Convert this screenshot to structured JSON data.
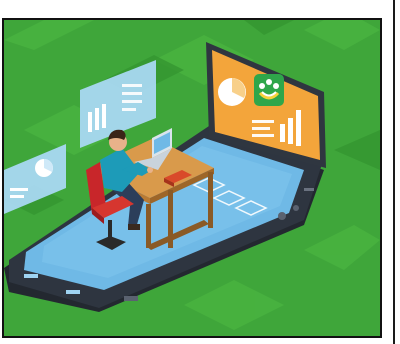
{
  "illustration": {
    "subject": "person-working-at-desk-on-smartphone-platform",
    "colors": {
      "background": "#3fa63a",
      "background_tile": "#49b340",
      "phone_body": "#2e3540",
      "phone_screen": "#6fb9e6",
      "monitor_frame": "#2f3640",
      "monitor_screen": "#f3a53b",
      "app_icon": "#2fa64a",
      "desk": "#c98a3e",
      "chair": "#c8262a",
      "shirt": "#1d9bb8",
      "floating_panel": "#a9d8f2"
    },
    "icons": [
      "pie-chart-icon",
      "bar-chart-icon",
      "app-logo-icon",
      "laptop-icon",
      "book-icon"
    ]
  }
}
